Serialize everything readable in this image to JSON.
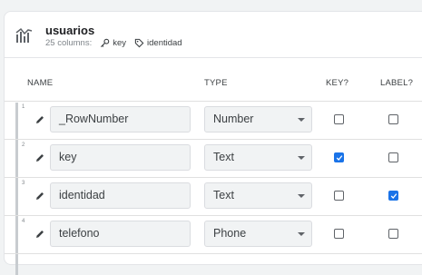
{
  "table": {
    "name": "usuarios",
    "columns_count": "25 columns:",
    "key_chip": "key",
    "label_chip": "identidad"
  },
  "headers": {
    "name": "NAME",
    "type": "TYPE",
    "key": "KEY?",
    "label": "LABEL?"
  },
  "rows": [
    {
      "num": "1",
      "name": "_RowNumber",
      "type": "Number",
      "key": false,
      "label": false
    },
    {
      "num": "2",
      "name": "key",
      "type": "Text",
      "key": true,
      "label": false
    },
    {
      "num": "3",
      "name": "identidad",
      "type": "Text",
      "key": false,
      "label": true
    },
    {
      "num": "4",
      "name": "telefono",
      "type": "Phone",
      "key": false,
      "label": false
    }
  ],
  "colors": {
    "accent": "#1a73e8"
  },
  "icons": {
    "table": "table-chart-icon",
    "key": "key-icon",
    "label": "tag-icon",
    "edit": "pencil-icon"
  }
}
